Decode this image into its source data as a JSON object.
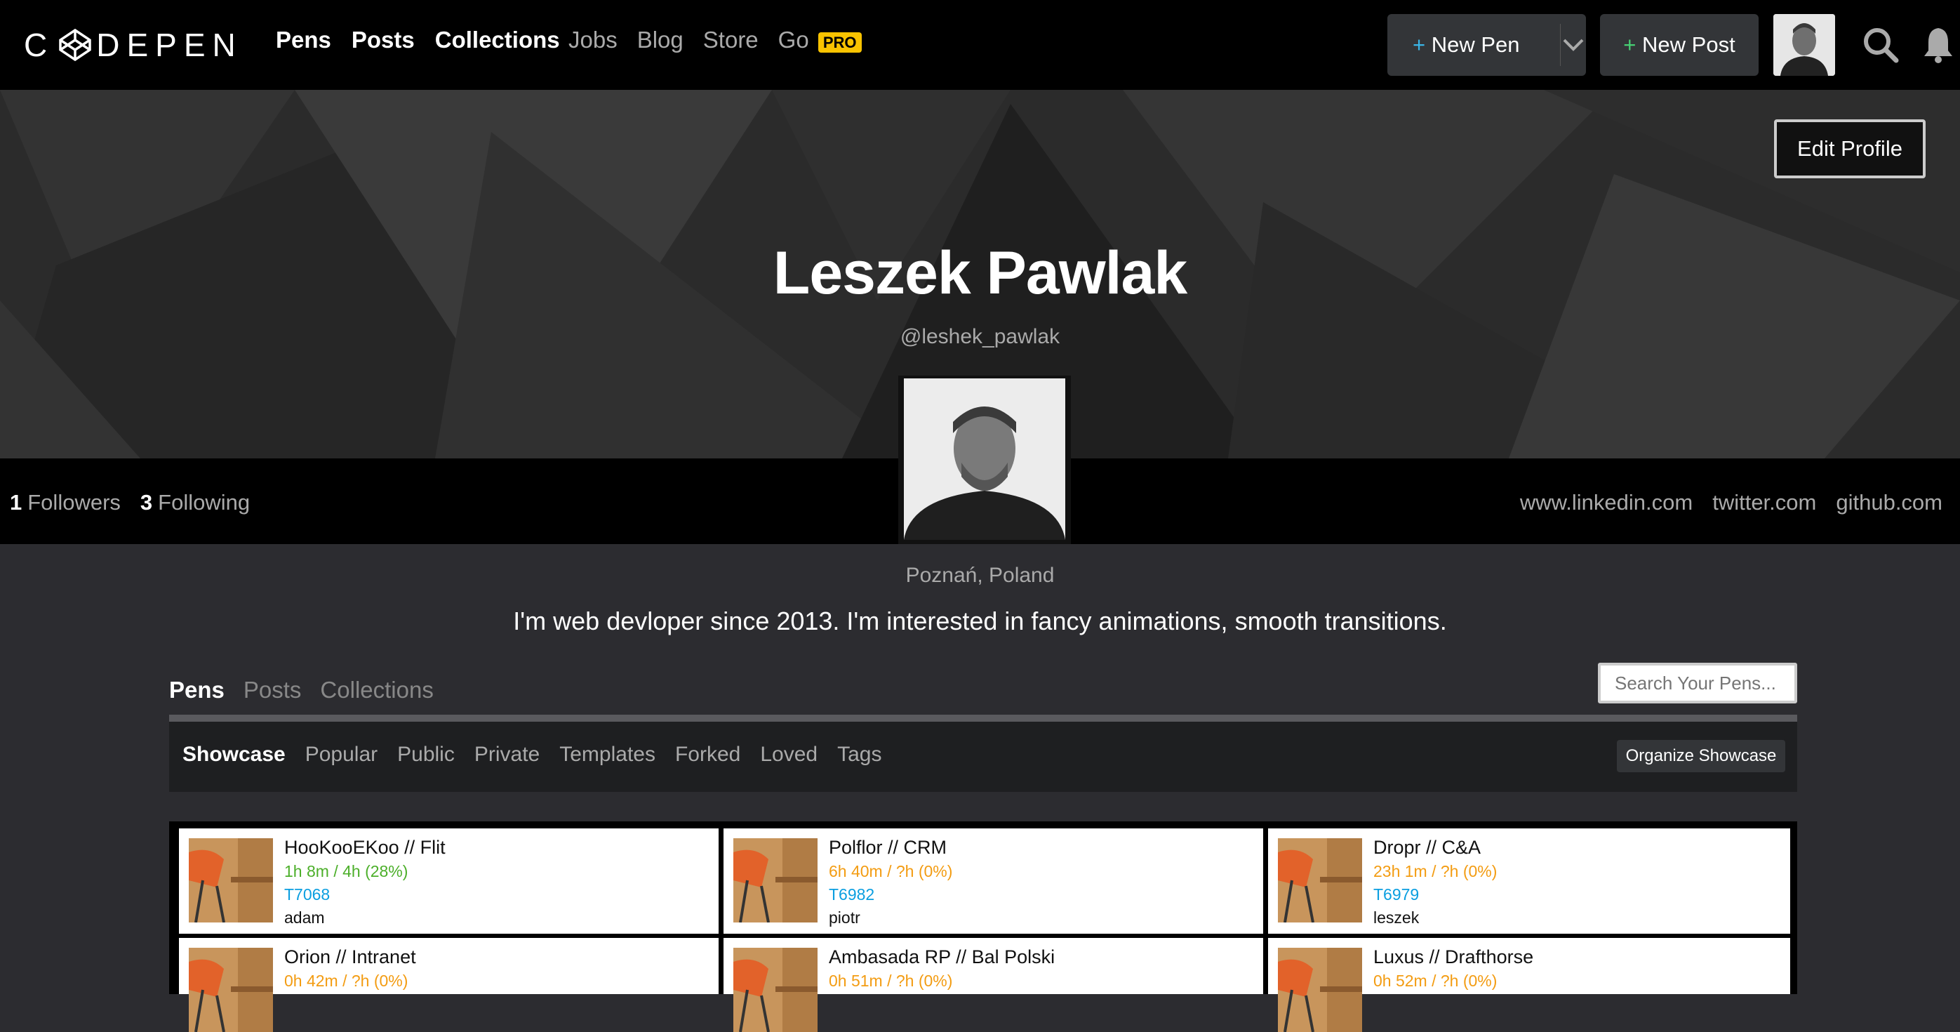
{
  "topbar": {
    "logo": "CODEPEN",
    "nav_main": [
      "Pens",
      "Posts",
      "Collections"
    ],
    "nav_secondary": [
      "Jobs",
      "Blog",
      "Store",
      "Go"
    ],
    "pro_badge": "PRO",
    "new_pen_label": "New Pen",
    "new_post_label": "New Post",
    "plus": "+"
  },
  "profile": {
    "edit_label": "Edit Profile",
    "name": "Leszek Pawlak",
    "handle": "@leshek_pawlak",
    "followers_count": "1",
    "followers_label": "Followers",
    "following_count": "3",
    "following_label": "Following",
    "links": [
      "www.linkedin.com",
      "twitter.com",
      "github.com"
    ],
    "location": "Poznań, Poland",
    "bio": "I'm web devloper since 2013. I'm interested in fancy animations, smooth transitions."
  },
  "tabs": {
    "items": [
      "Pens",
      "Posts",
      "Collections"
    ],
    "active": "Pens",
    "search_placeholder": "Search Your Pens..."
  },
  "subnav": {
    "items": [
      "Showcase",
      "Popular",
      "Public",
      "Private",
      "Templates",
      "Forked",
      "Loved",
      "Tags"
    ],
    "active": "Showcase",
    "organize_label": "Organize Showcase"
  },
  "cards": [
    {
      "title": "HooKooEKoo // Flit",
      "time": "1h 8m / 4h (28%)",
      "time_color": "#4caf2a",
      "ticket": "T7068",
      "user": "adam"
    },
    {
      "title": "Polflor // CRM",
      "time": "6h 40m / ?h (0%)",
      "time_color": "#f39c12",
      "ticket": "T6982",
      "user": "piotr"
    },
    {
      "title": "Dropr // C&A",
      "time": "23h 1m / ?h (0%)",
      "time_color": "#f39c12",
      "ticket": "T6979",
      "user": "leszek"
    },
    {
      "title": "Orion // Intranet",
      "time": "0h 42m / ?h (0%)",
      "time_color": "#f39c12",
      "ticket": "",
      "user": ""
    },
    {
      "title": "Ambasada RP // Bal Polski",
      "time": "0h 51m / ?h (0%)",
      "time_color": "#f39c12",
      "ticket": "",
      "user": ""
    },
    {
      "title": "Luxus // Drafthorse",
      "time": "0h 52m / ?h (0%)",
      "time_color": "#f39c12",
      "ticket": "",
      "user": ""
    }
  ]
}
